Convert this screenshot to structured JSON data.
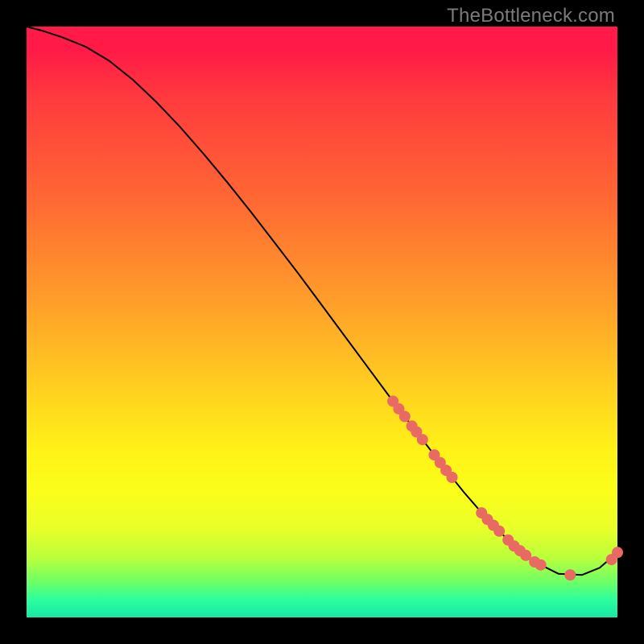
{
  "watermark": "TheBottleneck.com",
  "colors": {
    "curve": "#000000",
    "marker": "#e86a63"
  },
  "chart_data": {
    "type": "line",
    "title": "",
    "xlabel": "",
    "ylabel": "",
    "xlim": [
      0,
      100
    ],
    "ylim": [
      0,
      100
    ],
    "grid": false,
    "legend": false,
    "series": [
      {
        "name": "curve",
        "x": [
          0,
          3,
          6,
          10,
          14,
          18,
          22,
          26,
          30,
          34,
          38,
          42,
          46,
          50,
          54,
          58,
          62,
          66,
          70,
          74,
          78,
          82,
          86,
          90,
          94,
          97,
          100
        ],
        "y": [
          100,
          99.2,
          98.2,
          96.6,
          94.2,
          91.0,
          87.2,
          83.0,
          78.4,
          73.6,
          68.6,
          63.4,
          58.2,
          52.8,
          47.4,
          42.0,
          36.6,
          31.4,
          26.2,
          21.2,
          16.6,
          12.6,
          9.4,
          7.4,
          7.2,
          8.4,
          11.0
        ]
      }
    ],
    "markers": [
      {
        "x": 62.0,
        "y": 36.6
      },
      {
        "x": 63.0,
        "y": 35.3
      },
      {
        "x": 64.0,
        "y": 34.0
      },
      {
        "x": 65.2,
        "y": 32.4
      },
      {
        "x": 66.0,
        "y": 31.4
      },
      {
        "x": 67.0,
        "y": 30.1
      },
      {
        "x": 69.0,
        "y": 27.5
      },
      {
        "x": 70.0,
        "y": 26.2
      },
      {
        "x": 71.0,
        "y": 24.9
      },
      {
        "x": 72.0,
        "y": 23.7
      },
      {
        "x": 77.0,
        "y": 17.7
      },
      {
        "x": 78.0,
        "y": 16.6
      },
      {
        "x": 79.0,
        "y": 15.6
      },
      {
        "x": 80.0,
        "y": 14.6
      },
      {
        "x": 81.5,
        "y": 13.1
      },
      {
        "x": 82.5,
        "y": 12.1
      },
      {
        "x": 83.5,
        "y": 11.3
      },
      {
        "x": 84.5,
        "y": 10.5
      },
      {
        "x": 86.0,
        "y": 9.4
      },
      {
        "x": 87.0,
        "y": 8.9
      },
      {
        "x": 92.0,
        "y": 7.2
      },
      {
        "x": 99.0,
        "y": 9.8
      },
      {
        "x": 100.0,
        "y": 11.0
      }
    ]
  }
}
